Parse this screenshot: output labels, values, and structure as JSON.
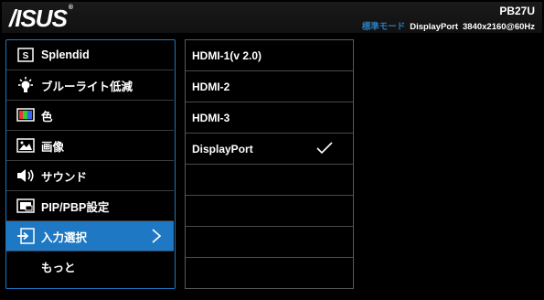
{
  "header": {
    "logo": "/ISUS",
    "logo_mark": "®",
    "model": "PB27U",
    "mode": "標準モード",
    "input": "DisplayPort",
    "resolution": "3840x2160@60Hz"
  },
  "menu": {
    "items": [
      {
        "label": "Splendid",
        "icon": "splendid-icon"
      },
      {
        "label": "ブルーライト低減",
        "icon": "blue-light-icon"
      },
      {
        "label": "色",
        "icon": "color-icon"
      },
      {
        "label": "画像",
        "icon": "image-icon"
      },
      {
        "label": "サウンド",
        "icon": "speaker-icon"
      },
      {
        "label": "PIP/PBP設定",
        "icon": "pip-icon"
      },
      {
        "label": "入力選択",
        "icon": "input-select-icon",
        "selected": true
      },
      {
        "label": "もっと",
        "icon": ""
      }
    ]
  },
  "submenu": {
    "items": [
      {
        "label": "HDMI-1(v 2.0)",
        "checked": false
      },
      {
        "label": "HDMI-2",
        "checked": false
      },
      {
        "label": "HDMI-3",
        "checked": false
      },
      {
        "label": "DisplayPort",
        "checked": true
      },
      {
        "label": "",
        "checked": false
      },
      {
        "label": "",
        "checked": false
      },
      {
        "label": "",
        "checked": false
      },
      {
        "label": "",
        "checked": false
      }
    ]
  },
  "colors": {
    "accent": "#1f78c3",
    "mode_text": "#2a7ab8",
    "background": "#000000"
  }
}
